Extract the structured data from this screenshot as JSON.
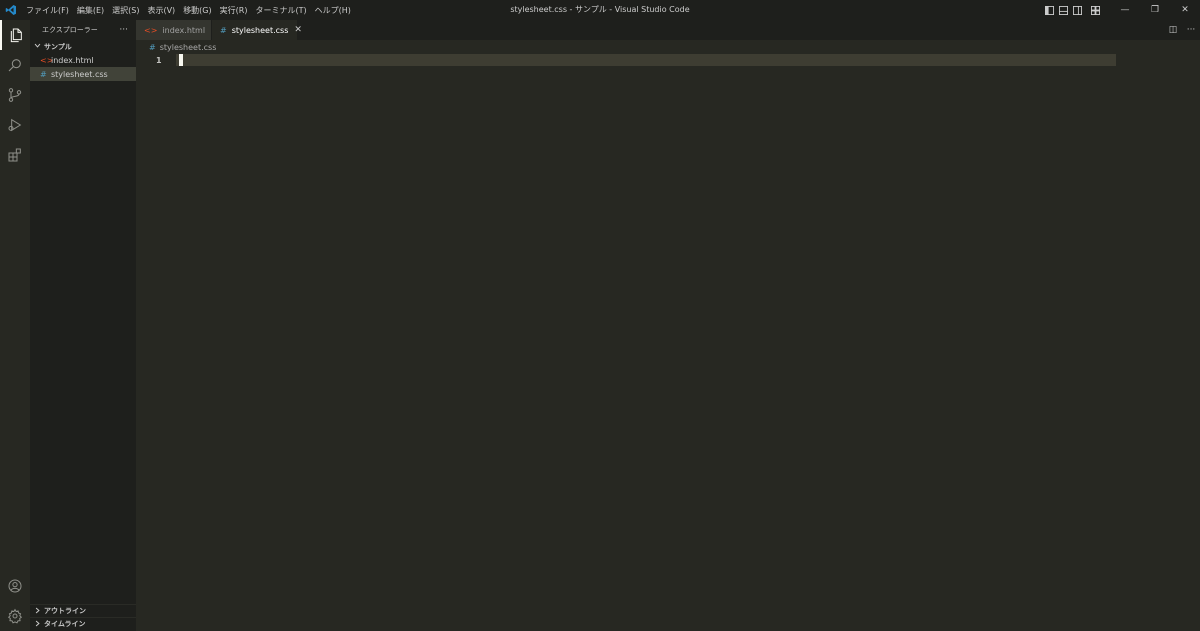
{
  "titlebar": {
    "menu": [
      "ファイル(F)",
      "編集(E)",
      "選択(S)",
      "表示(V)",
      "移動(G)",
      "実行(R)",
      "ターミナル(T)",
      "ヘルプ(H)"
    ],
    "window_title": "stylesheet.css - サンプル - Visual Studio Code",
    "window_buttons": {
      "minimize": "—",
      "restore": "❐",
      "close": "✕"
    }
  },
  "activitybar": {
    "items": [
      "files-icon",
      "search-icon",
      "source-control-icon",
      "run-debug-icon",
      "extensions-icon"
    ],
    "bottom": [
      "account-icon",
      "settings-gear-icon"
    ]
  },
  "sidebar": {
    "title": "エクスプローラー",
    "more": "···",
    "folder": "サンプル",
    "files": [
      {
        "name": "index.html",
        "icon": "<>",
        "icon_color": "#e44d26"
      },
      {
        "name": "stylesheet.css",
        "icon": "#",
        "icon_color": "#519aba"
      }
    ],
    "sections": [
      "アウトライン",
      "タイムライン"
    ]
  },
  "tabs": [
    {
      "label": "index.html",
      "icon": "<>",
      "icon_color": "#e44d26"
    },
    {
      "label": "stylesheet.css",
      "icon": "#",
      "icon_color": "#519aba",
      "close": "✕"
    }
  ],
  "tab_actions": [
    "◫",
    "···"
  ],
  "breadcrumb": {
    "icon": "#",
    "label": "stylesheet.css"
  },
  "editor": {
    "line_numbers": [
      "1"
    ]
  }
}
